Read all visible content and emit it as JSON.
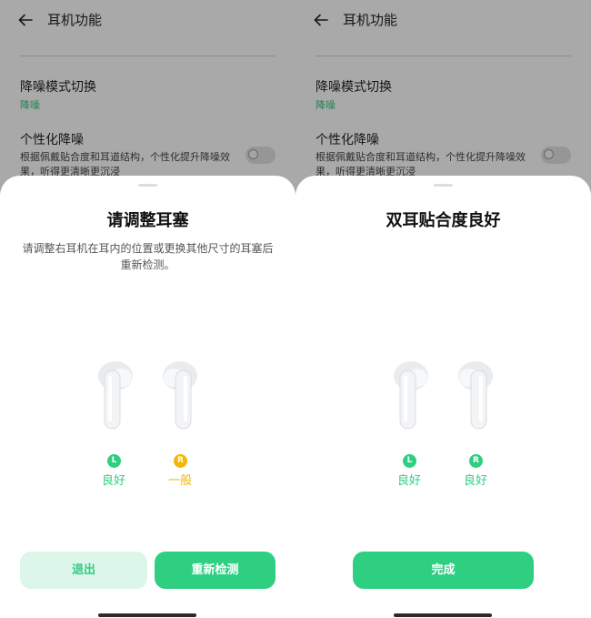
{
  "colors": {
    "accent": "#2fcf82",
    "accent_light": "#dcf6ea",
    "good": "#2fcf82",
    "fair": "#f2b705"
  },
  "screens": [
    {
      "header": {
        "title": "耳机功能"
      },
      "settings": {
        "anc_switch": {
          "title": "降噪模式切换",
          "value": "降噪"
        },
        "personalized_anc": {
          "title": "个性化降噪",
          "description": "根据佩戴贴合度和耳道结构，个性化提升降噪效果，听得更清晰更沉浸"
        }
      },
      "sheet": {
        "title": "请调整耳塞",
        "description": "请调整右耳机在耳内的位置或更换其他尺寸的耳塞后重新检测。",
        "left": {
          "badge": "L",
          "status": "良好",
          "level": "good"
        },
        "right": {
          "badge": "R",
          "status": "一般",
          "level": "fair"
        },
        "buttons": {
          "exit": "退出",
          "retest": "重新检测"
        }
      }
    },
    {
      "header": {
        "title": "耳机功能"
      },
      "settings": {
        "anc_switch": {
          "title": "降噪模式切换",
          "value": "降噪"
        },
        "personalized_anc": {
          "title": "个性化降噪",
          "description": "根据佩戴贴合度和耳道结构，个性化提升降噪效果，听得更清晰更沉浸"
        }
      },
      "sheet": {
        "title": "双耳贴合度良好",
        "left": {
          "badge": "L",
          "status": "良好",
          "level": "good"
        },
        "right": {
          "badge": "R",
          "status": "良好",
          "level": "good"
        },
        "buttons": {
          "done": "完成"
        }
      }
    }
  ]
}
